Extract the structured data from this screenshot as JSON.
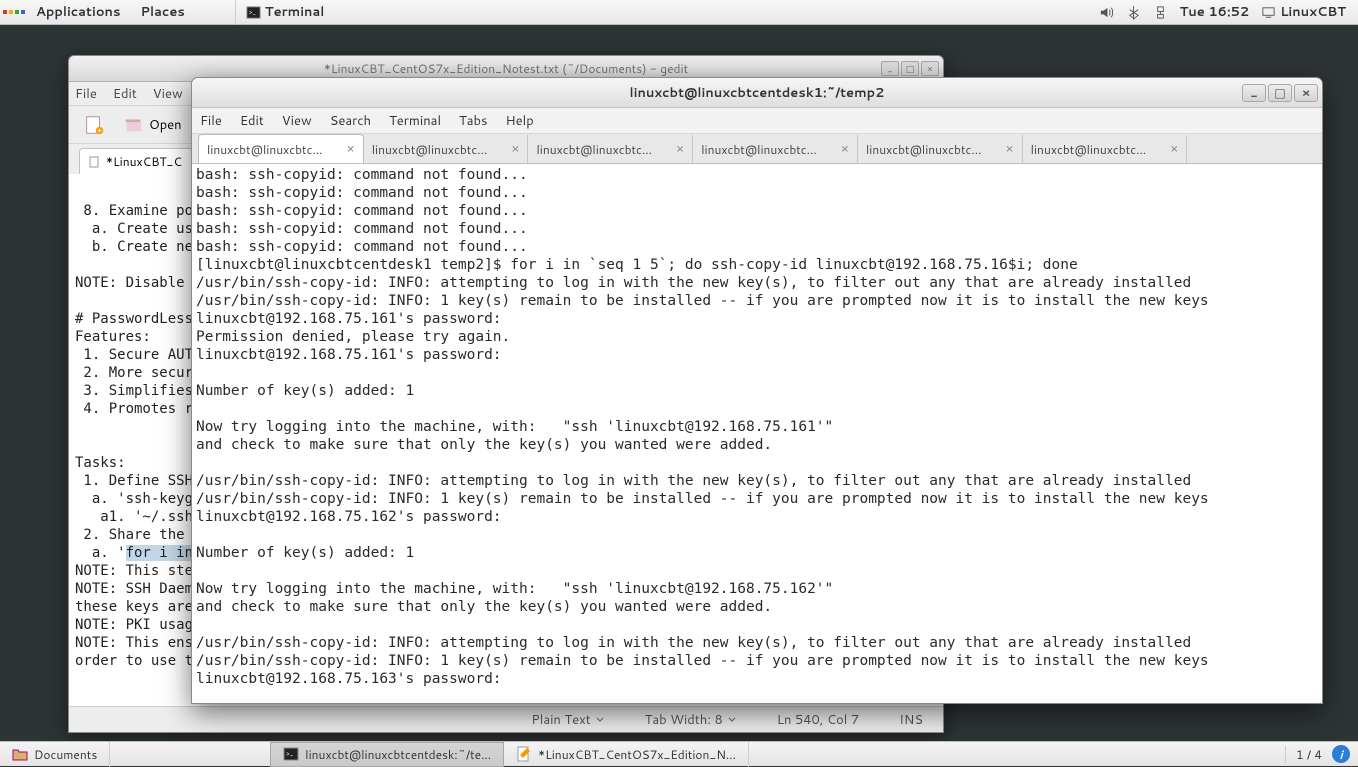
{
  "topbar": {
    "applications": "Applications",
    "places": "Places",
    "active_app": "Terminal",
    "clock": "Tue 16:52",
    "user": "LinuxCBT"
  },
  "gedit": {
    "title": "*LinuxCBT_CentOS7x_Edition_Notest.txt (~/Documents) - gedit",
    "menus": [
      "File",
      "Edit",
      "View"
    ],
    "toolbar": {
      "open": "Open"
    },
    "tab_label": "*LinuxCBT_C",
    "editor_lines": [
      "",
      " 8. Examine po",
      "  a. Create us",
      "  b. Create ne",
      "",
      "NOTE: Disable ",
      "",
      "# PasswordLess",
      "Features:",
      " 1. Secure AUT",
      " 2. More secur",
      " 3. Simplifies",
      " 4. Promotes r",
      "",
      "",
      "Tasks:",
      " 1. Define SSH",
      "  a. 'ssh-keyg",
      "   a1. '~/.ssh",
      " 2. Share the ",
      "  a. 'for i in",
      "NOTE: This ste",
      "NOTE: SSH Daem",
      "these keys are",
      "NOTE: PKI usag",
      "NOTE: This ens",
      "order to use t"
    ],
    "selected_prefix": "  a. '",
    "selected_text": "for i in",
    "statusbar": {
      "plain": "Plain Text",
      "tabwidth": "Tab Width:  8",
      "lncol": "Ln 540, Col 7",
      "ins": "INS"
    }
  },
  "terminal": {
    "title": "linuxcbt@linuxcbtcentdesk1:~/temp2",
    "menus": [
      "File",
      "Edit",
      "View",
      "Search",
      "Terminal",
      "Tabs",
      "Help"
    ],
    "tabs": [
      "linuxcbt@linuxcbtc...",
      "linuxcbt@linuxcbtc...",
      "linuxcbt@linuxcbtc...",
      "linuxcbt@linuxcbtc...",
      "linuxcbt@linuxcbtc...",
      "linuxcbt@linuxcbtc..."
    ],
    "content": "bash: ssh-copyid: command not found...\nbash: ssh-copyid: command not found...\nbash: ssh-copyid: command not found...\nbash: ssh-copyid: command not found...\nbash: ssh-copyid: command not found...\n[linuxcbt@linuxcbtcentdesk1 temp2]$ for i in `seq 1 5`; do ssh-copy-id linuxcbt@192.168.75.16$i; done\n/usr/bin/ssh-copy-id: INFO: attempting to log in with the new key(s), to filter out any that are already installed\n/usr/bin/ssh-copy-id: INFO: 1 key(s) remain to be installed -- if you are prompted now it is to install the new keys\nlinuxcbt@192.168.75.161's password:\nPermission denied, please try again.\nlinuxcbt@192.168.75.161's password:\n\nNumber of key(s) added: 1\n\nNow try logging into the machine, with:   \"ssh 'linuxcbt@192.168.75.161'\"\nand check to make sure that only the key(s) you wanted were added.\n\n/usr/bin/ssh-copy-id: INFO: attempting to log in with the new key(s), to filter out any that are already installed\n/usr/bin/ssh-copy-id: INFO: 1 key(s) remain to be installed -- if you are prompted now it is to install the new keys\nlinuxcbt@192.168.75.162's password:\n\nNumber of key(s) added: 1\n\nNow try logging into the machine, with:   \"ssh 'linuxcbt@192.168.75.162'\"\nand check to make sure that only the key(s) you wanted were added.\n\n/usr/bin/ssh-copy-id: INFO: attempting to log in with the new key(s), to filter out any that are already installed\n/usr/bin/ssh-copy-id: INFO: 1 key(s) remain to be installed -- if you are prompted now it is to install the new keys\nlinuxcbt@192.168.75.163's password:"
  },
  "bottombar": {
    "tasks": [
      "Documents",
      "linuxcbt@linuxcbtcentdesk:~/te...",
      "*LinuxCBT_CentOS7x_Edition_N..."
    ],
    "workspace": "1 / 4"
  }
}
